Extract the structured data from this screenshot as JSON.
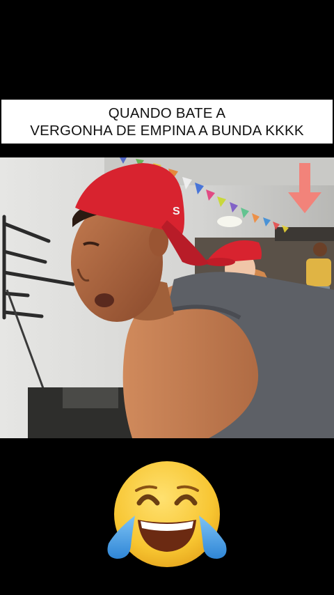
{
  "caption": {
    "line1": "QUANDO BATE A",
    "line2": "VERGONHA DE EMPINA A BUNDA KKKK"
  },
  "photo": {
    "scene": "gym",
    "cap_logo_letter": "S"
  },
  "emoji": {
    "icon": "face-with-tears-of-joy-icon"
  },
  "colors": {
    "background": "#000000",
    "caption_bg": "#ffffff",
    "cap_red": "#d8232f",
    "arrow": "#f2837a",
    "emoji_yellow": "#f7c531",
    "tear_blue": "#4fa6e8"
  }
}
